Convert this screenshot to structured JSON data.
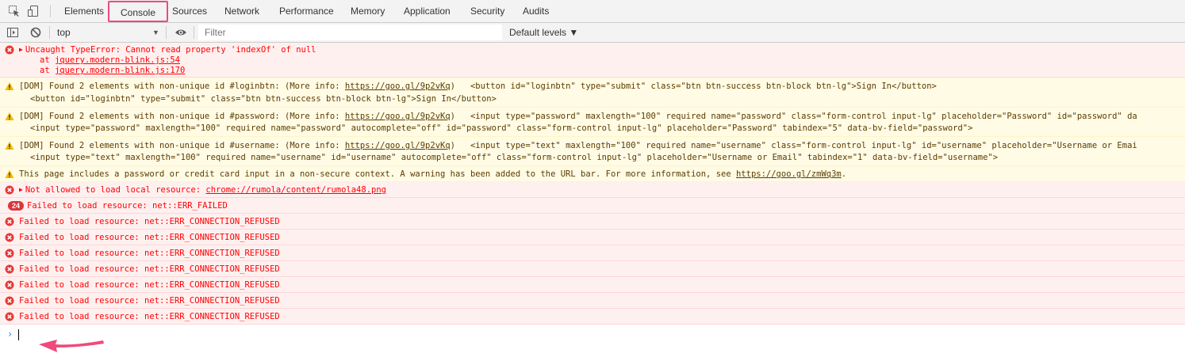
{
  "tabs": [
    {
      "label": "Elements",
      "selected": false
    },
    {
      "label": "Console",
      "selected": true
    },
    {
      "label": "Sources",
      "selected": false
    },
    {
      "label": "Network",
      "selected": false
    },
    {
      "label": "Performance",
      "selected": false
    },
    {
      "label": "Memory",
      "selected": false
    },
    {
      "label": "Application",
      "selected": false
    },
    {
      "label": "Security",
      "selected": false
    },
    {
      "label": "Audits",
      "selected": false
    }
  ],
  "toolbar": {
    "context": "top",
    "filter_placeholder": "Filter",
    "levels": "Default levels ▼",
    "icons": [
      "inspect-icon",
      "device-toolbar-icon",
      "sidebar-toggle-icon",
      "clear-console-icon",
      "eye-icon"
    ]
  },
  "colors": {
    "highlight": "#ee4a7c",
    "error_bg": "#fff0f0",
    "error_text": "#ff0000",
    "warn_bg": "#fffbe5",
    "warn_icon": "#f4bd00"
  },
  "messages": [
    {
      "level": "error",
      "icon": "error-icon",
      "lines": [
        "Uncaught TypeError: Cannot read property 'indexOf' of null"
      ],
      "stack": [
        "at ",
        "at "
      ],
      "stack_links": [
        "jquery.modern-blink.js:54",
        "jquery.modern-blink.js:170"
      ]
    },
    {
      "level": "warn",
      "icon": "warning-icon",
      "prefix": "[DOM] Found 2 elements with non-unique id #loginbtn: (More info: ",
      "link": "https://goo.gl/9p2vKq",
      "suffix": ")   <button id=\"loginbtn\" type=\"submit\" class=\"btn btn-success btn-block btn-lg\">Sign In</button>",
      "second": "<button id=\"loginbtn\" type=\"submit\" class=\"btn btn-success btn-block btn-lg\">Sign In</button>"
    },
    {
      "level": "warn",
      "icon": "warning-icon",
      "prefix": "[DOM] Found 2 elements with non-unique id #password: (More info: ",
      "link": "https://goo.gl/9p2vKq",
      "suffix": ")   <input type=\"password\" maxlength=\"100\" required name=\"password\" class=\"form-control input-lg\" placeholder=\"Password\" id=\"password\" da",
      "second": "<input type=\"password\" maxlength=\"100\" required name=\"password\" autocomplete=\"off\" id=\"password\" class=\"form-control input-lg\" placeholder=\"Password\" tabindex=\"5\" data-bv-field=\"password\">"
    },
    {
      "level": "warn",
      "icon": "warning-icon",
      "prefix": "[DOM] Found 2 elements with non-unique id #username: (More info: ",
      "link": "https://goo.gl/9p2vKq",
      "suffix": ")   <input type=\"text\" maxlength=\"100\" required name=\"username\" class=\"form-control input-lg\" id=\"username\" placeholder=\"Username or Emai",
      "second": "<input type=\"text\" maxlength=\"100\" required name=\"username\" id=\"username\" autocomplete=\"off\" class=\"form-control input-lg\" placeholder=\"Username or Email\" tabindex=\"1\" data-bv-field=\"username\">"
    },
    {
      "level": "warn",
      "icon": "warning-icon",
      "prefix": "This page includes a password or credit card input in a non-secure context. A warning has been added to the URL bar. For more information, see ",
      "link": "https://goo.gl/zmWq3m",
      "suffix": "."
    },
    {
      "level": "error",
      "icon": "error-icon",
      "prefix": "Not allowed to load local resource: ",
      "link": "chrome://rumola/content/rumola48.png"
    },
    {
      "level": "error",
      "badge": "24",
      "text": "Failed to load resource: net::ERR_FAILED"
    },
    {
      "level": "error",
      "icon": "error-icon",
      "text": "Failed to load resource: net::ERR_CONNECTION_REFUSED"
    },
    {
      "level": "error",
      "icon": "error-icon",
      "text": "Failed to load resource: net::ERR_CONNECTION_REFUSED"
    },
    {
      "level": "error",
      "icon": "error-icon",
      "text": "Failed to load resource: net::ERR_CONNECTION_REFUSED"
    },
    {
      "level": "error",
      "icon": "error-icon",
      "text": "Failed to load resource: net::ERR_CONNECTION_REFUSED"
    },
    {
      "level": "error",
      "icon": "error-icon",
      "text": "Failed to load resource: net::ERR_CONNECTION_REFUSED"
    },
    {
      "level": "error",
      "icon": "error-icon",
      "text": "Failed to load resource: net::ERR_CONNECTION_REFUSED"
    },
    {
      "level": "error",
      "icon": "error-icon",
      "text": "Failed to load resource: net::ERR_CONNECTION_REFUSED"
    }
  ],
  "prompt": {
    "caret": "›",
    "icons": [
      "arrow-annotation-icon"
    ]
  }
}
